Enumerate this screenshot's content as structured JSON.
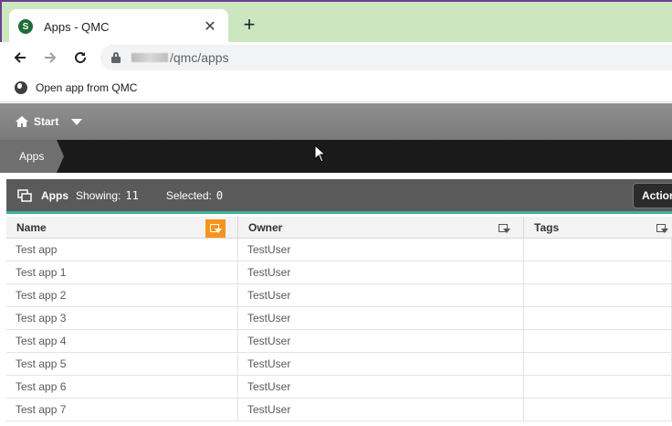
{
  "browser": {
    "tab_title": "Apps - QMC",
    "tab_favicon_letter": "S",
    "url_path": "/qmc/apps",
    "bookmark_label": "Open app from QMC"
  },
  "app": {
    "start_label": "Start",
    "breadcrumb": "Apps",
    "section_title": "Apps",
    "showing_label": "Showing:",
    "showing_count": "11",
    "selected_label": "Selected:",
    "selected_count": "0",
    "actions_label": "Actions"
  },
  "table": {
    "columns": [
      "Name",
      "Owner",
      "Tags"
    ],
    "rows": [
      {
        "name": "Test app",
        "owner": "TestUser",
        "tags": ""
      },
      {
        "name": "Test app 1",
        "owner": "TestUser",
        "tags": ""
      },
      {
        "name": "Test app 2",
        "owner": "TestUser",
        "tags": ""
      },
      {
        "name": "Test app 3",
        "owner": "TestUser",
        "tags": ""
      },
      {
        "name": "Test app 4",
        "owner": "TestUser",
        "tags": ""
      },
      {
        "name": "Test app 5",
        "owner": "TestUser",
        "tags": ""
      },
      {
        "name": "Test app 6",
        "owner": "TestUser",
        "tags": ""
      },
      {
        "name": "Test app 7",
        "owner": "TestUser",
        "tags": ""
      }
    ]
  },
  "colors": {
    "tabstrip": "#cce6c0",
    "accent_teal": "#3bb39a",
    "filter_active": "#f7941d",
    "header_bar": "#5a5a5a"
  },
  "icons": [
    "qlik-favicon-icon",
    "close-icon",
    "plus-icon",
    "back-arrow-icon",
    "forward-arrow-icon",
    "reload-icon",
    "lock-icon",
    "globe-icon",
    "home-icon",
    "chevron-down-icon",
    "apps-icon",
    "filter-icon",
    "mouse-cursor-icon"
  ]
}
